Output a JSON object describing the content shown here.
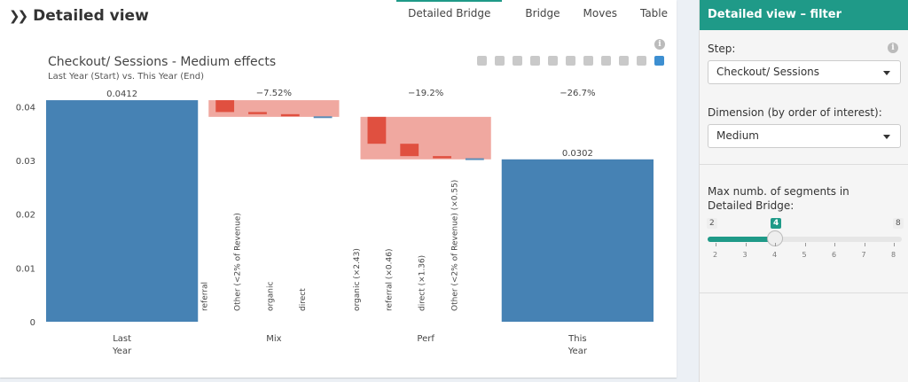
{
  "panel": {
    "title": "Detailed view",
    "tabs": [
      "Detailed Bridge",
      "Bridge",
      "Moves",
      "Table"
    ]
  },
  "chart": {
    "title": "Checkout/ Sessions - Medium effects",
    "subtitle": "Last Year (Start) vs. This Year (End)",
    "modebar_icons": [
      "camera-icon",
      "zoom-icon",
      "pan-icon",
      "zoom-in-icon",
      "zoom-out-icon",
      "autoscale-icon",
      "home-icon",
      "spike-lines-icon",
      "hover-closest-icon",
      "hover-compare-icon",
      "plotly-logo-icon"
    ]
  },
  "chart_data": {
    "type": "bar",
    "categories": [
      "Last Year",
      "Mix",
      "Perf",
      "This Year"
    ],
    "ylim": [
      0,
      0.045
    ],
    "yticks": [
      "0",
      "0.01",
      "0.02",
      "0.03",
      "0.04"
    ],
    "colors": {
      "total": "#4682b4",
      "band": "#f0a8a0",
      "segment": "#e05040",
      "small": "#5b8db8"
    },
    "totals": [
      {
        "category": "Last Year",
        "value": 0.0412,
        "label": "0.0412"
      },
      {
        "category": "This Year",
        "value": 0.0302,
        "label": "0.0302"
      }
    ],
    "groups": [
      {
        "category": "Mix",
        "top": 0.0412,
        "bottom": 0.0381,
        "change_label": "−7.52%",
        "segments": [
          {
            "name": "referral",
            "from": 0.0412,
            "to": 0.039
          },
          {
            "name": "Other (<2% of Revenue)",
            "from": 0.039,
            "to": 0.0386
          },
          {
            "name": "organic",
            "from": 0.0386,
            "to": 0.0382
          },
          {
            "name": "direct",
            "from": 0.0382,
            "to": 0.0381
          }
        ]
      },
      {
        "category": "Perf",
        "top": 0.0381,
        "bottom": 0.0302,
        "change_label": "−19.2%",
        "segments": [
          {
            "name": "organic (×2.43)",
            "from": 0.0381,
            "to": 0.0331
          },
          {
            "name": "referral (×0.46)",
            "from": 0.0331,
            "to": 0.0308
          },
          {
            "name": "direct (×1.36)",
            "from": 0.0308,
            "to": 0.0304
          },
          {
            "name": "Other (<2% of Revenue) (×0.55)",
            "from": 0.0304,
            "to": 0.0302
          }
        ]
      }
    ],
    "overall_change_label": "−26.7%"
  },
  "sidebar": {
    "title": "Detailed view – filter",
    "step_label": "Step:",
    "step_value": "Checkout/ Sessions",
    "dimension_label": "Dimension (by order of interest):",
    "dimension_value": "Medium",
    "slider_label": "Max numb. of segments in Detailed Bridge:",
    "slider_min": 2,
    "slider_max": 8,
    "slider_value": 4,
    "slider_ticks": [
      "2",
      "3",
      "4",
      "5",
      "6",
      "7",
      "8"
    ]
  }
}
